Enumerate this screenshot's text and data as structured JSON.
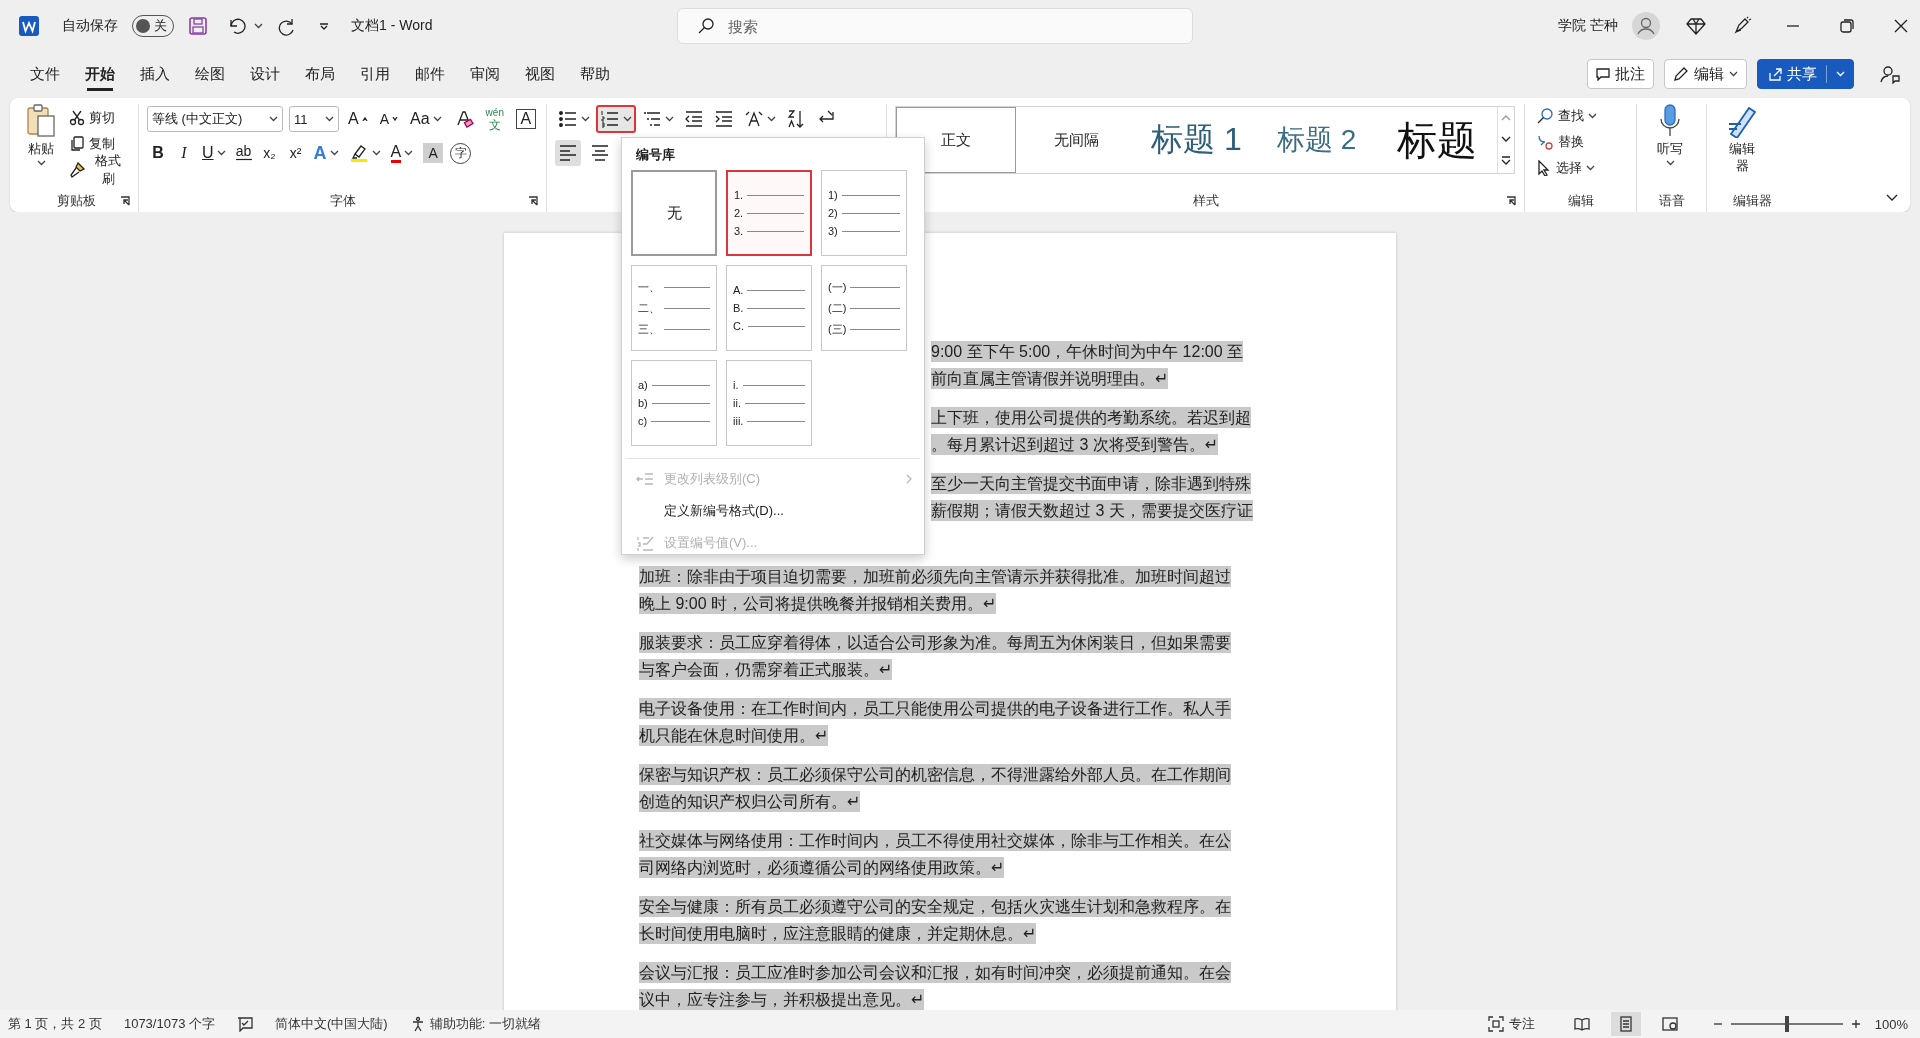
{
  "title_bar": {
    "autosave_label": "自动保存",
    "autosave_on": false,
    "autosave_state": "关",
    "document_title": "文档1 - Word",
    "search_placeholder": "搜索",
    "user_name": "学院 芒种"
  },
  "menu_tabs": [
    {
      "label": "文件",
      "selected": false
    },
    {
      "label": "开始",
      "selected": true
    },
    {
      "label": "插入",
      "selected": false
    },
    {
      "label": "绘图",
      "selected": false
    },
    {
      "label": "设计",
      "selected": false
    },
    {
      "label": "布局",
      "selected": false
    },
    {
      "label": "引用",
      "selected": false
    },
    {
      "label": "邮件",
      "selected": false
    },
    {
      "label": "审阅",
      "selected": false
    },
    {
      "label": "视图",
      "selected": false
    },
    {
      "label": "帮助",
      "selected": false
    }
  ],
  "header_buttons": {
    "comments": "批注",
    "editing": "编辑",
    "share": "共享"
  },
  "ribbon": {
    "clipboard": {
      "paste": "粘贴",
      "cut": "剪切",
      "copy": "复制",
      "format_painter": "格式刷",
      "label": "剪贴板"
    },
    "font": {
      "font_name": "等线 (中文正文)",
      "font_size": "11",
      "label": "字体",
      "row1": [
        {
          "kind": "grow",
          "text": "A"
        },
        {
          "kind": "shrink",
          "text": "A"
        },
        {
          "kind": "case",
          "text": "Aa"
        },
        {
          "kind": "clear"
        },
        {
          "kind": "phonetic",
          "text": "wén",
          "sub": "文"
        },
        {
          "kind": "border",
          "text": "A"
        }
      ],
      "row2": [
        {
          "kind": "bold",
          "text": "B"
        },
        {
          "kind": "italic",
          "text": "I"
        },
        {
          "kind": "underline",
          "text": "U"
        },
        {
          "kind": "strike",
          "text": "ab"
        },
        {
          "kind": "subscript",
          "text": "x₂"
        },
        {
          "kind": "superscript",
          "text": "x²"
        },
        {
          "kind": "effects",
          "text": "A"
        },
        {
          "kind": "highlight"
        },
        {
          "kind": "color",
          "text": "A"
        },
        {
          "kind": "shading",
          "text": "A"
        },
        {
          "kind": "enclose",
          "text": "字"
        }
      ]
    },
    "paragraph": {
      "numbering_selected": true,
      "align_left_selected": true
    },
    "styles": {
      "label": "样式",
      "items": [
        {
          "label": "正文",
          "kind": "normal",
          "selected": true
        },
        {
          "label": "无间隔",
          "kind": "normal",
          "selected": false
        },
        {
          "label": "标题 1",
          "kind": "heading1",
          "selected": false
        },
        {
          "label": "标题 2",
          "kind": "heading2",
          "selected": false
        },
        {
          "label": "标题",
          "kind": "title",
          "selected": false
        }
      ]
    },
    "editing": {
      "find": "查找",
      "replace": "替换",
      "select": "选择",
      "label": "编辑"
    },
    "voice": {
      "dictate": "听写",
      "label": "语音"
    },
    "editor": {
      "button": "编辑器",
      "label": "编辑器"
    }
  },
  "numbering_menu": {
    "title": "编号库",
    "options": [
      {
        "kind": "none",
        "label": "无",
        "selected": false
      },
      {
        "kind": "list",
        "markers": [
          "1.",
          "2.",
          "3."
        ],
        "selected": true
      },
      {
        "kind": "list",
        "markers": [
          "1)",
          "2)",
          "3)"
        ],
        "selected": false
      },
      {
        "kind": "list",
        "markers": [
          "一、",
          "二、",
          "三、"
        ],
        "selected": false
      },
      {
        "kind": "list",
        "markers": [
          "A.",
          "B.",
          "C."
        ],
        "selected": false
      },
      {
        "kind": "list",
        "markers": [
          "(一)",
          "(二)",
          "(三)"
        ],
        "selected": false
      },
      {
        "kind": "list",
        "markers": [
          "a)",
          "b)",
          "c)"
        ],
        "selected": false
      },
      {
        "kind": "list",
        "markers": [
          "i.",
          "ii.",
          "iii."
        ],
        "selected": false
      }
    ],
    "commands": [
      {
        "kind": "level",
        "label": "更改列表级别(C)",
        "disabled": true
      },
      {
        "kind": "define",
        "label": "定义新编号格式(D)...",
        "disabled": false
      },
      {
        "kind": "value",
        "label": "设置编号值(V)...",
        "disabled": true
      }
    ]
  },
  "document": {
    "paragraphs": [
      {
        "lines": [
          {
            "kind": "partial",
            "text": "9:00 至下午 5:00，午休时间为中午 12:00 至"
          },
          {
            "kind": "partial",
            "text": "前向直属主管请假并说明理由。↵"
          }
        ]
      },
      {
        "lines": [
          {
            "kind": "partial",
            "text": "上下班，使用公司提供的考勤系统。若迟到超"
          },
          {
            "kind": "partial",
            "text": "。每月累计迟到超过 3 次将受到警告。↵"
          }
        ]
      },
      {
        "lines": [
          {
            "kind": "partial",
            "text": "至少一天向主管提交书面申请，除非遇到特殊"
          },
          {
            "kind": "partial",
            "text": "薪假期；请假天数超过 3 天，需要提交医疗证"
          },
          {
            "kind": "covered"
          }
        ]
      },
      {
        "lines": [
          {
            "kind": "full",
            "text": "加班：除非由于项目迫切需要，加班前必须先向主管请示并获得批准。加班时间超过"
          },
          {
            "kind": "full",
            "text": "晚上 9:00 时，公司将提供晚餐并报销相关费用。↵"
          }
        ]
      },
      {
        "lines": [
          {
            "kind": "full",
            "text": "服装要求：员工应穿着得体，以适合公司形象为准。每周五为休闲装日，但如果需要"
          },
          {
            "kind": "full",
            "text": "与客户会面，仍需穿着正式服装。↵"
          }
        ]
      },
      {
        "lines": [
          {
            "kind": "full",
            "text": "电子设备使用：在工作时间内，员工只能使用公司提供的电子设备进行工作。私人手"
          },
          {
            "kind": "full",
            "text": "机只能在休息时间使用。↵"
          }
        ]
      },
      {
        "lines": [
          {
            "kind": "full",
            "text": "保密与知识产权：员工必须保守公司的机密信息，不得泄露给外部人员。在工作期间"
          },
          {
            "kind": "full",
            "text": "创造的知识产权归公司所有。↵"
          }
        ]
      },
      {
        "lines": [
          {
            "kind": "full",
            "text": "社交媒体与网络使用：工作时间内，员工不得使用社交媒体，除非与工作相关。在公"
          },
          {
            "kind": "full",
            "text": "司网络内浏览时，必须遵循公司的网络使用政策。↵"
          }
        ]
      },
      {
        "lines": [
          {
            "kind": "full",
            "text": "安全与健康：所有员工必须遵守公司的安全规定，包括火灾逃生计划和急救程序。在"
          },
          {
            "kind": "full",
            "text": "长时间使用电脑时，应注意眼睛的健康，并定期休息。↵"
          }
        ]
      },
      {
        "lines": [
          {
            "kind": "full",
            "text": "会议与汇报：员工应准时参加公司会议和汇报，如有时间冲突，必须提前通知。在会"
          },
          {
            "kind": "full",
            "text": "议中，应专注参与，并积极提出意见。↵"
          }
        ]
      }
    ]
  },
  "status_bar": {
    "page": "第 1 页，共 2 页",
    "words": "1073/1073 个字",
    "language": "简体中文(中国大陆)",
    "accessibility": "辅助功能: 一切就绪",
    "focus": "专注",
    "views": [
      {
        "kind": "read",
        "selected": false
      },
      {
        "kind": "print",
        "selected": true
      },
      {
        "kind": "web",
        "selected": false
      }
    ],
    "zoom": {
      "level": 0.5,
      "reading": "100%"
    }
  }
}
